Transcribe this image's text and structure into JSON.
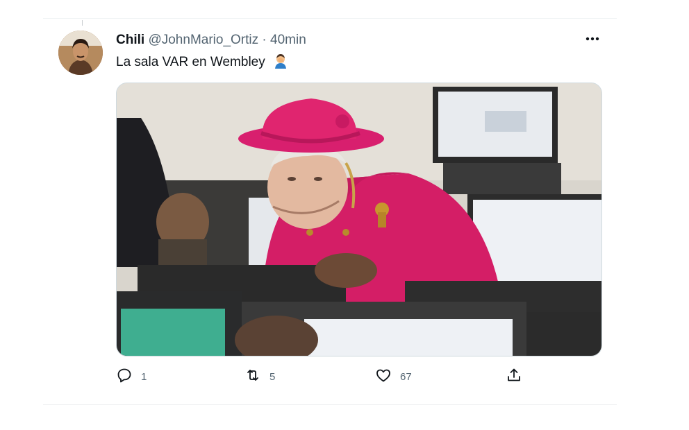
{
  "tweet": {
    "author_name": "Chili",
    "handle": "@JohnMario_Ortiz",
    "separator": "·",
    "time": "40min",
    "text": "La sala VAR en Wembley",
    "emoji": "man-facepalming-emoji",
    "more_icon": "more-horizontal-icon",
    "media": {
      "description_icon": "photo-queen-in-pink-at-computers",
      "colors": {
        "hat": "#d81f6e",
        "coat": "#d41e66",
        "monitor_frame": "#2b2b2b",
        "wall": "#d8d4cc"
      }
    },
    "actions": {
      "reply": {
        "icon": "reply-icon",
        "count": "1"
      },
      "retweet": {
        "icon": "retweet-icon",
        "count": "5"
      },
      "like": {
        "icon": "like-icon",
        "count": "67"
      },
      "share": {
        "icon": "share-icon"
      }
    }
  },
  "colors": {
    "text": "#0f1419",
    "muted": "#536471",
    "border": "#cfd9de"
  }
}
